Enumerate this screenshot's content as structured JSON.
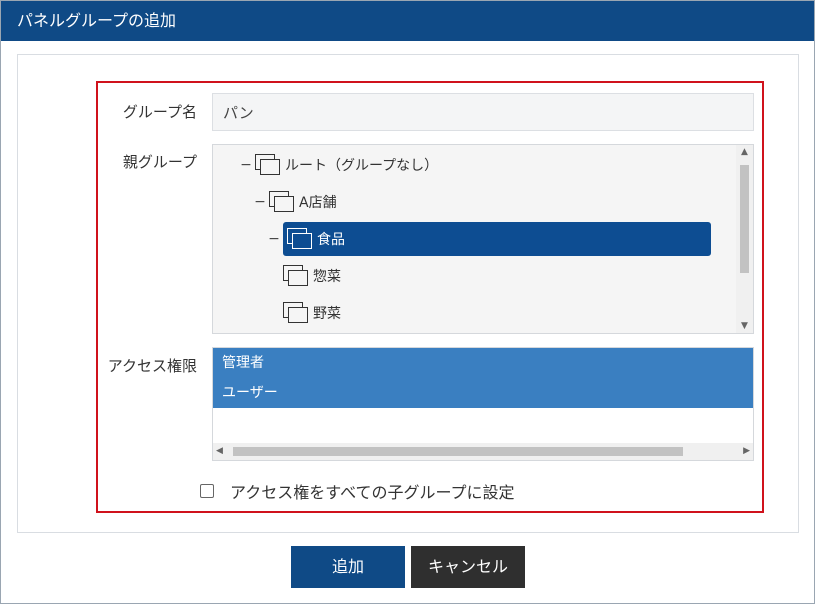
{
  "dialog": {
    "title": "パネルグループの追加"
  },
  "form": {
    "group_name_label": "グループ名",
    "group_name_value": "パン",
    "parent_group_label": "親グループ",
    "access_label": "アクセス権限",
    "apply_all_label": "アクセス権をすべての子グループに設定"
  },
  "tree": {
    "items": [
      {
        "toggle": "−",
        "label": "ルート（グループなし）",
        "level": 0,
        "selected": false
      },
      {
        "toggle": "−",
        "label": "A店舗",
        "level": 1,
        "selected": false
      },
      {
        "toggle": "−",
        "label": "食品",
        "level": 2,
        "selected": true
      },
      {
        "toggle": "",
        "label": "惣菜",
        "level": 3,
        "selected": false
      },
      {
        "toggle": "",
        "label": "野菜",
        "level": 3,
        "selected": false
      }
    ]
  },
  "access": {
    "items": [
      {
        "label": "管理者",
        "selected": true
      },
      {
        "label": "ユーザー",
        "selected": true
      }
    ]
  },
  "buttons": {
    "add": "追加",
    "cancel": "キャンセル"
  },
  "colors": {
    "titlebar": "#0f4a86",
    "selected_tree": "#0d4d92",
    "selected_list": "#3a7fc1",
    "highlight_frame": "#d0121c",
    "cancel_button": "#2f2f2f"
  }
}
